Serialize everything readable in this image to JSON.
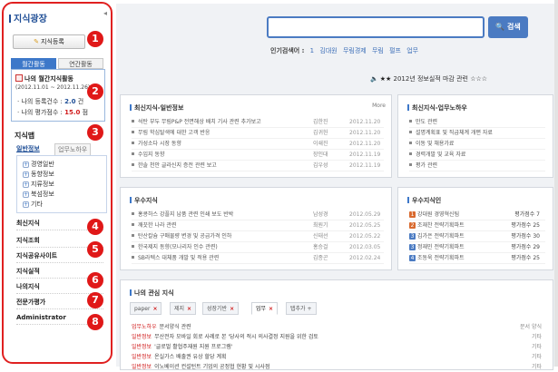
{
  "sidebar": {
    "title": "지식광장",
    "register_label": "지식등록",
    "tabs": [
      "월간활동",
      "연간활동"
    ],
    "activity": {
      "title": "나의 월간지식활동",
      "period": "(2012.11.01 ~ 2012.11.26)",
      "registered_label": "· 나의 등록건수 :",
      "registered_value": "2.0",
      "registered_unit": "건",
      "rating_label": "· 나의 평가점수 :",
      "rating_value": "15.0",
      "rating_unit": "점"
    },
    "map_title": "지식맵",
    "map_tabs": [
      "일반정보",
      "업무노하우"
    ],
    "tree": [
      "경영일반",
      "동향정보",
      "지류정보",
      "북섬정보",
      "기타"
    ],
    "menu": [
      "최신지식",
      "지식조회",
      "지식공유사이트",
      "지식실적",
      "나의지식",
      "전문가평가",
      "Administrator"
    ]
  },
  "badges": [
    "1",
    "2",
    "3",
    "4",
    "5",
    "6",
    "7",
    "8"
  ],
  "search": {
    "button_label": "검색",
    "popular_label": "인기검색어 :",
    "keywords": [
      "1",
      "김대원",
      "무림경제",
      "무림",
      "펄프",
      "업무"
    ]
  },
  "notice": {
    "text": "2012년 정보실적 마감 관련",
    "stars_left": "★★",
    "stars_right": "☆☆☆"
  },
  "panels": {
    "recent_general": {
      "title": "최신지식-일반정보",
      "more": "More",
      "rows": [
        {
          "title": "석탄 부두 무림P&P 전면해상 배치 기사 관련 추가보고",
          "author": "김한진",
          "date": "2012.11.20"
        },
        {
          "title": "무림 학심탈색에 대한 고객 반응",
          "author": "김귀헌",
          "date": "2012.11.20"
        },
        {
          "title": "가성소다 시장 동향",
          "author": "이쇄진",
          "date": "2012.11.20"
        },
        {
          "title": "수입지 동향",
          "author": "장인대",
          "date": "2012.11.19"
        },
        {
          "title": "한솔 천안 글라신지 증전 관련 보고",
          "author": "김우성",
          "date": "2012.11.19"
        }
      ]
    },
    "recent_knowhow": {
      "title": "최신지식-업무노하우",
      "rows": [
        "만도 관련",
        "설명계획표 및 직급체계 개편 자료",
        "이동 및 채용가료",
        "경력개발 및 교육 자료",
        "평가 관련"
      ]
    },
    "best_knowledge": {
      "title": "우수지식",
      "rows": [
        {
          "title": "홍콩하스 강플지 납품 관련 인쇄 보도 반박",
          "author": "남성경",
          "date": "2012.05.29"
        },
        {
          "title": "깨끗한 나라 관련",
          "author": "최원기",
          "date": "2012.05.25"
        },
        {
          "title": "탄산칼슘 구매물량 변경 및 공급가격 인하",
          "author": "신태선",
          "date": "2012.05.22"
        },
        {
          "title": "한국제지 동향(모나리자 인수 관련)",
          "author": "홍승걸",
          "date": "2012.03.05"
        },
        {
          "title": "SB라텍스 대체품 개발 및 적용 관련",
          "author": "김종곤",
          "date": "2012.02.24"
        }
      ]
    },
    "best_people": {
      "title": "우수지식인",
      "rows": [
        {
          "badge": "1",
          "name": "강대원",
          "dept": "경영혁신팀",
          "score": "평가점수 7"
        },
        {
          "badge": "2",
          "name": "조재찬",
          "dept": "전략기획파트",
          "score": "평가점수 25"
        },
        {
          "badge": "3",
          "name": "김가은",
          "dept": "전략기획파트",
          "score": "평가점수 30"
        },
        {
          "badge": "3",
          "name": "정재민",
          "dept": "전략기획파트",
          "score": "평가점수 29"
        },
        {
          "badge": "4",
          "name": "조동욱",
          "dept": "전략기획파트",
          "score": "평가점수 25"
        }
      ]
    },
    "interest": {
      "title": "나의 관심 지식",
      "tabs": [
        "paper",
        "제지",
        "성장기반",
        "업무",
        "탭추가 +"
      ],
      "rows": [
        {
          "cat": "업무노하우",
          "title": "문서양식 관련",
          "right": "문서 양식"
        },
        {
          "cat": "일반정보",
          "title": "무산전자 모바일 회로 사례로 본 '당사의 적시 의사결정 지원을 위한 검토",
          "right": "기타"
        },
        {
          "cat": "일반정보",
          "title": "'글로벌 활협주재원 지원 프로그램'",
          "right": "기타"
        },
        {
          "cat": "일반정보",
          "title": "온실가스 배출권 유상 할당 계획",
          "right": "기타"
        },
        {
          "cat": "일반정보",
          "title": "이노베이션 컨설턴트 기업의 공정협 현황 및 시사점",
          "right": "기타"
        }
      ]
    }
  }
}
